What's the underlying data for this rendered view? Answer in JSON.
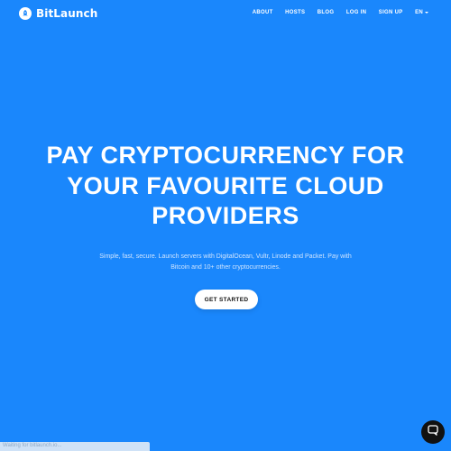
{
  "brand": {
    "name": "BitLaunch",
    "icon": "rocket-icon"
  },
  "nav": {
    "items": [
      "ABOUT",
      "HOSTS",
      "BLOG",
      "LOG IN",
      "SIGN UP"
    ],
    "language": "EN"
  },
  "hero": {
    "title_line1": "PAY CRYPTOCURRENCY FOR",
    "title_line2": "YOUR FAVOURITE CLOUD",
    "title_line3": "PROVIDERS",
    "subtitle_line1": "Simple, fast, secure. Launch servers with DigitalOcean, Vultr, Linode and Packet. Pay with",
    "subtitle_line2": "Bitcoin and 10+ other cryptocurrencies.",
    "cta_label": "GET STARTED"
  },
  "status_bar": {
    "text": "Waiting for bitlaunch.io..."
  },
  "chat": {
    "icon": "chat-bubble-icon"
  },
  "colors": {
    "background": "#1a87fc",
    "text": "#ffffff",
    "cta_background": "#ffffff",
    "cta_text": "#111111",
    "chat_button": "#111111"
  }
}
